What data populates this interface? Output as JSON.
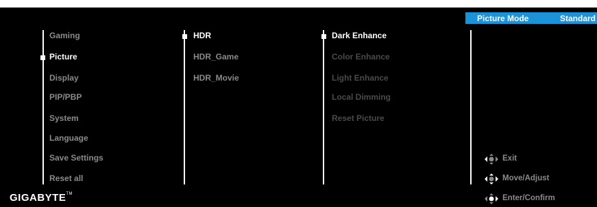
{
  "header": {
    "mode_label": "Picture Mode",
    "mode_value": "Standard"
  },
  "main_menu": {
    "items": [
      {
        "label": "Gaming",
        "state": "dim"
      },
      {
        "label": "Picture",
        "state": "active"
      },
      {
        "label": "Display",
        "state": "dim"
      },
      {
        "label": "PIP/PBP",
        "state": "dim"
      },
      {
        "label": "System",
        "state": "dim"
      },
      {
        "label": "Language",
        "state": "dim"
      },
      {
        "label": "Save Settings",
        "state": "dim"
      },
      {
        "label": "Reset all",
        "state": "dim"
      }
    ]
  },
  "sub_menu": {
    "items": [
      {
        "label": "HDR",
        "state": "active"
      },
      {
        "label": "HDR_Game",
        "state": "dim"
      },
      {
        "label": "HDR_Movie",
        "state": "dim"
      }
    ]
  },
  "third_menu": {
    "items": [
      {
        "label": "Dark Enhance",
        "state": "active"
      },
      {
        "label": "Color Enhance",
        "state": "disabled"
      },
      {
        "label": "Light Enhance",
        "state": "disabled"
      },
      {
        "label": "Local Dimming",
        "state": "disabled"
      },
      {
        "label": "Reset Picture",
        "state": "disabled"
      }
    ]
  },
  "hints": [
    {
      "label": "Exit",
      "icon": "joystick-left-icon"
    },
    {
      "label": "Move/Adjust",
      "icon": "joystick-move-icon"
    },
    {
      "label": "Enter/Confirm",
      "icon": "joystick-press-icon"
    }
  ],
  "brand": {
    "logo_text": "GIGABYTE",
    "trademark": "TM"
  },
  "colors": {
    "background": "#000000",
    "accent": "#1c93d8",
    "active_text": "#ffffff",
    "inactive_text": "#8a8a8a",
    "disabled_text": "#4a4a4a"
  }
}
